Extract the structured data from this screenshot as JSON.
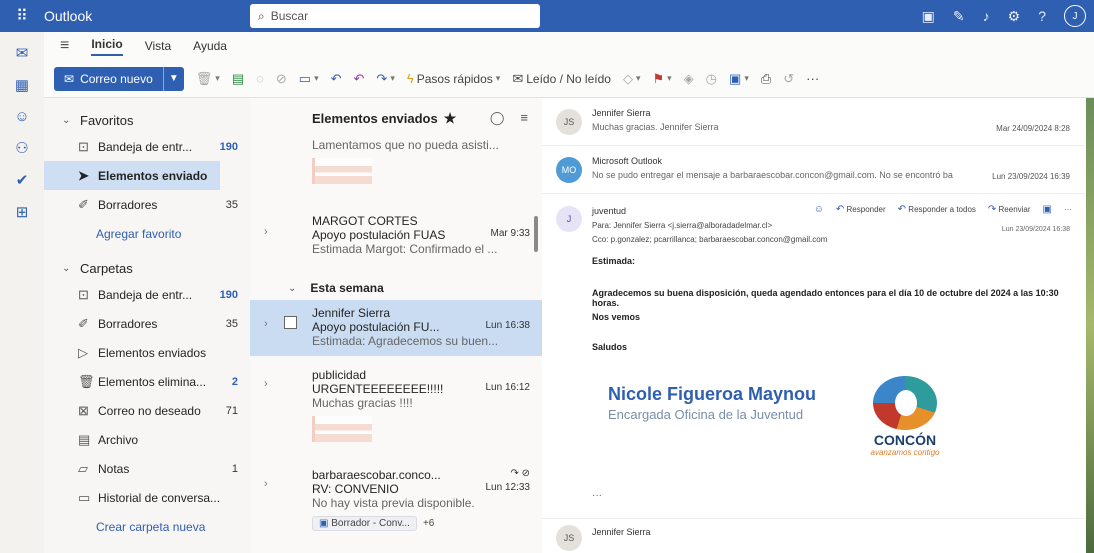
{
  "topbar": {
    "app_name": "Outlook",
    "search_placeholder": "Buscar",
    "avatar_initial": "J"
  },
  "ribbon": {
    "tabs": [
      "Inicio",
      "Vista",
      "Ayuda"
    ],
    "new_mail": "Correo nuevo",
    "quick_steps": "Pasos rápidos",
    "read_unread": "Leído / No leído"
  },
  "favorites": {
    "header": "Favoritos",
    "items": [
      {
        "label": "Bandeja de entr...",
        "count": "190",
        "icon": "inbox-icon"
      },
      {
        "label": "Elementos enviados",
        "count": "",
        "icon": "send-icon"
      },
      {
        "label": "Borradores",
        "count": "35",
        "icon": "draft-icon"
      }
    ],
    "add_link": "Agregar favorito"
  },
  "folders": {
    "header": "Carpetas",
    "items": [
      {
        "label": "Bandeja de entr...",
        "count": "190"
      },
      {
        "label": "Borradores",
        "count": "35"
      },
      {
        "label": "Elementos enviados",
        "count": ""
      },
      {
        "label": "Elementos elimina...",
        "count": "2"
      },
      {
        "label": "Correo no deseado",
        "count": "71"
      },
      {
        "label": "Archivo",
        "count": ""
      },
      {
        "label": "Notas",
        "count": "1"
      },
      {
        "label": "Historial de conversa...",
        "count": ""
      }
    ],
    "create_link": "Crear carpeta nueva"
  },
  "message_list": {
    "title": "Elementos enviados",
    "week_header": "Esta semana",
    "messages": [
      {
        "from": "",
        "subject": "",
        "time": "",
        "preview": "Lamentamos que no pueda asisti..."
      },
      {
        "from": "MARGOT CORTES",
        "subject": "Apoyo postulación FUAS",
        "time": "Mar 9:33",
        "preview": "Estimada Margot: Confirmado el ..."
      },
      {
        "from": "Jennifer Sierra",
        "subject": "Apoyo postulación FU...",
        "time": "Lun 16:38",
        "preview": "Estimada: Agradecemos su buen..."
      },
      {
        "from": "publicidad",
        "subject": "URGENTEEEEEEEE!!!!!",
        "time": "Lun 16:12",
        "preview": "Muchas gracias !!!!"
      },
      {
        "from": "barbaraescobar.conco...",
        "subject": "RV: CONVENIO",
        "time": "Lun 12:33",
        "preview": "No hay vista previa disponible.",
        "draft": "Borrador - Conv...",
        "draft_extra": "+6"
      }
    ]
  },
  "reading": {
    "threads": [
      {
        "initials": "JS",
        "from": "Jennifer Sierra",
        "preview": "Muchas gracias. Jennifer Sierra",
        "date": "Mar 24/09/2024 8:28"
      },
      {
        "initials": "MO",
        "from": "Microsoft Outlook",
        "preview": "No se pudo entregar el mensaje a barbaraescobar.concon@gmail.com. No se encontró ba",
        "date": "Lun 23/09/2024 16:39"
      }
    ],
    "open": {
      "initial": "J",
      "from": "juventud",
      "actions": [
        "Responder",
        "Responder a todos",
        "Reenviar"
      ],
      "to": "Para: Jennifer Sierra <j.sierra@alboradadelmar.cl>",
      "cc": "Cco: p.gonzalez; pcarrillanca; barbaraescobar.concon@gmail.com",
      "date": "Lun 23/09/2024 16:38",
      "greeting": "Estimada:",
      "line1_pre": "Agradecemos su buena disposición, queda agendado entonces para el",
      "line1_bold": "día 10 de octubre del 2024 a las 10:30 horas.",
      "line2": "Nos vemos",
      "closing": "Saludos",
      "sig_name": "Nicole Figueroa Maynou",
      "sig_role": "Encargada Oficina de la Juventud",
      "logo_text": "CONCÓN",
      "logo_tag": "avanzamos contigo",
      "more": "···"
    },
    "last_thread": {
      "initials": "JS",
      "from": "Jennifer Sierra"
    }
  }
}
